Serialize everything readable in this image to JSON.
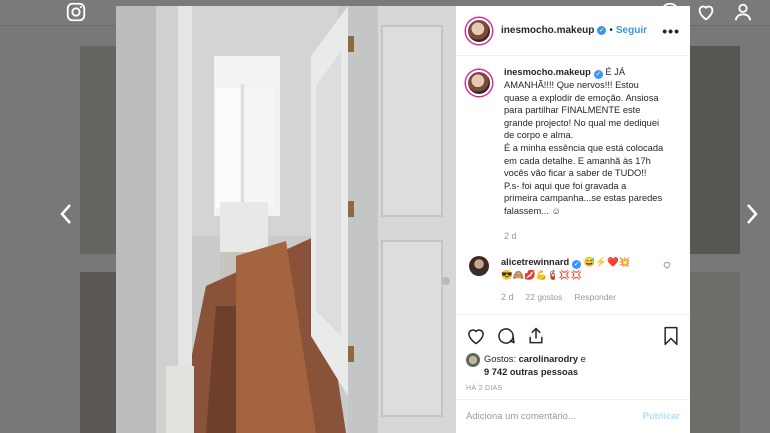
{
  "post": {
    "username": "inesmocho.makeup",
    "follow_label": "Seguir",
    "separator": "•",
    "more_label": "•••",
    "caption_username": "inesmocho.makeup",
    "caption_lines": [
      "É JÁ",
      "AMANHÃ!!!! Que nervos!!! Estou",
      "quase a explodir de emoção. Ansiosa",
      "para partilhar FINALMENTE este",
      "grande projecto! No qual me dediquei",
      "de corpo e alma.",
      "É a minha essência que está colocada",
      "em cada detalhe. E amanhã às 17h",
      "vocês vão ficar a saber de TUDO!!",
      "P.s- foi aqui que foi gravada a",
      "primeira campanha...se estas paredes",
      "falassem... ☺"
    ],
    "caption_age": "2 d"
  },
  "comment": {
    "username": "alicetrewinnard",
    "emoji_line1": "😅⚡❤️💥",
    "emoji_line2": "😎🙈💋💪🧯💢💢",
    "age": "2 d",
    "likes": "22 gostos",
    "reply_label": "Responder"
  },
  "likes": {
    "prefix": "Gostos:",
    "user": "carolinarodry",
    "connector": "e",
    "others": "9 742 outras pessoas"
  },
  "timestamp": "HÁ 2 DIAS",
  "add_comment": {
    "placeholder": "Adiciona um comentário...",
    "publish_label": "Publicar"
  },
  "icons": {
    "nav_left": "chevron-left-icon",
    "nav_right": "chevron-right-icon",
    "like": "heart-icon",
    "comment": "comment-icon",
    "share": "share-icon",
    "save": "bookmark-icon"
  },
  "colors": {
    "accent": "#3897f0",
    "publish_disabled": "#b2dffc",
    "muted": "#999999"
  }
}
